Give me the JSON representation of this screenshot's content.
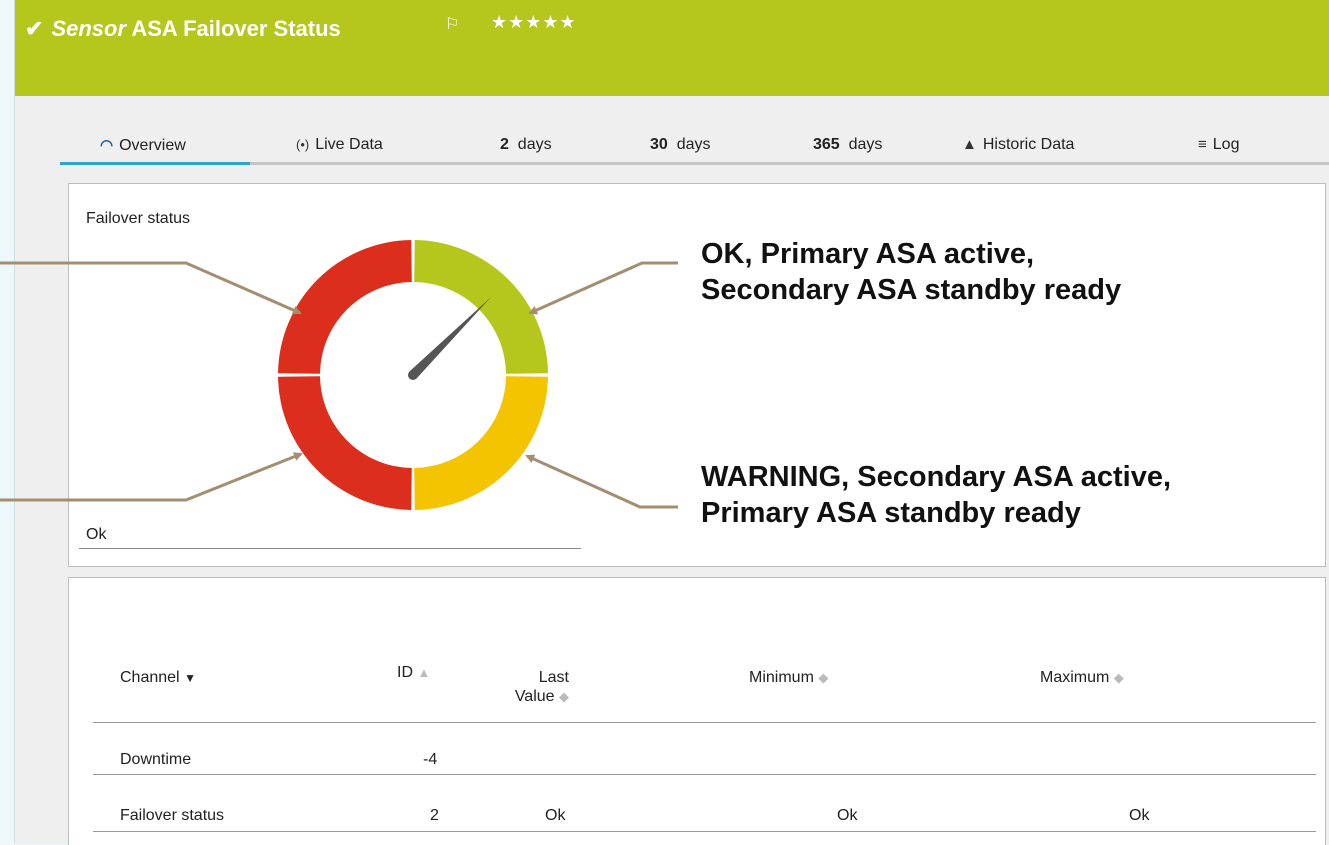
{
  "header": {
    "check": "✔",
    "title_italic": "Sensor",
    "title": "ASA Failover Status",
    "flag": "⚐",
    "stars": "★★★★★"
  },
  "tabs": [
    {
      "icon": "◠",
      "label": "Overview"
    },
    {
      "icon": "(•)",
      "label": "Live Data"
    },
    {
      "bold": "2",
      "label": "days"
    },
    {
      "bold": "30",
      "label": "days"
    },
    {
      "bold": "365",
      "label": "days"
    },
    {
      "icon": "▲",
      "label": "Historic Data"
    },
    {
      "icon": "≡",
      "label": "Log"
    }
  ],
  "gauge": {
    "title": "Failover status",
    "value": "Ok",
    "needle_fraction": 0.375,
    "colors": {
      "red": "#dc2e1c",
      "green": "#b5c71d",
      "yellow": "#f5c400",
      "needle": "#555555"
    }
  },
  "callouts": {
    "ok_line1": "OK, Primary ASA active,",
    "ok_line2": "Secondary ASA standby ready",
    "warn_line1": "WARNING, Secondary ASA active,",
    "warn_line2": "Primary ASA standby ready",
    "arrow_color": "#a48e72"
  },
  "table": {
    "headers": {
      "channel": "Channel",
      "id": "ID",
      "last_line1": "Last",
      "last_line2": "Value",
      "minimum": "Minimum",
      "maximum": "Maximum"
    },
    "rows": [
      {
        "channel": "Downtime",
        "id": "-4",
        "last": "",
        "minimum": "",
        "maximum": ""
      },
      {
        "channel": "Failover status",
        "id": "2",
        "last": "Ok",
        "minimum": "Ok",
        "maximum": "Ok"
      }
    ]
  }
}
